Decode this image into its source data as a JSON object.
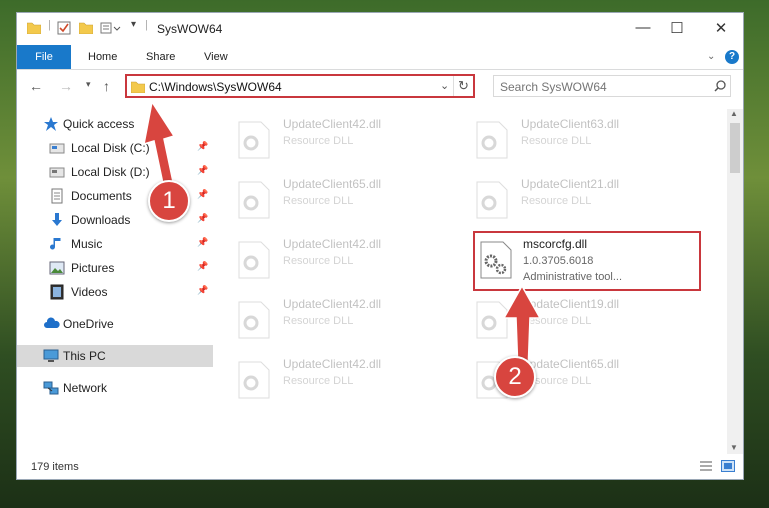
{
  "window": {
    "title": "SysWOW64",
    "controls": {
      "minimize": "—",
      "maximize": "☐",
      "close": "✕"
    }
  },
  "ribbon": {
    "file": "File",
    "tabs": [
      "Home",
      "Share",
      "View"
    ]
  },
  "address": {
    "path": "C:\\Windows\\SysWOW64",
    "search_placeholder": "Search SysWOW64"
  },
  "sidebar": {
    "quick_access": "Quick access",
    "pinned": [
      {
        "label": "Local Disk (C:)",
        "icon": "drive-icon"
      },
      {
        "label": "Local Disk (D:)",
        "icon": "drive-icon"
      },
      {
        "label": "Documents",
        "icon": "documents-icon"
      },
      {
        "label": "Downloads",
        "icon": "downloads-icon"
      },
      {
        "label": "Music",
        "icon": "music-icon"
      },
      {
        "label": "Pictures",
        "icon": "pictures-icon"
      },
      {
        "label": "Videos",
        "icon": "videos-icon"
      }
    ],
    "onedrive": "OneDrive",
    "thispc": "This PC",
    "network": "Network"
  },
  "files": [
    {
      "name": "UpdateClient42.dll",
      "meta": "Resource DLL"
    },
    {
      "name": "UpdateClient63.dll",
      "meta": "Resource DLL"
    },
    {
      "name": "UpdateClient65.dll",
      "meta": "Resource DLL"
    },
    {
      "name": "UpdateClient21.dll",
      "meta": "Resource DLL"
    },
    {
      "name": "UpdateClient42.dll",
      "meta": "Resource DLL"
    },
    {
      "name": "mscorcfg.dll",
      "meta": "1.0.3705.6018",
      "meta2": "Administrative tool..."
    },
    {
      "name": "UpdateClient42.dll",
      "meta": "Resource DLL"
    },
    {
      "name": "UpdateClient19.dll",
      "meta": "Resource DLL"
    },
    {
      "name": "UpdateClient42.dll",
      "meta": "Resource DLL"
    },
    {
      "name": "UpdateClient65.dll",
      "meta": "Resource DLL"
    }
  ],
  "status": {
    "items": "179 items"
  },
  "annotations": {
    "step1": "1",
    "step2": "2"
  },
  "colors": {
    "accent": "#1979ca",
    "highlight": "#c9373d",
    "badge": "#d8453f"
  }
}
